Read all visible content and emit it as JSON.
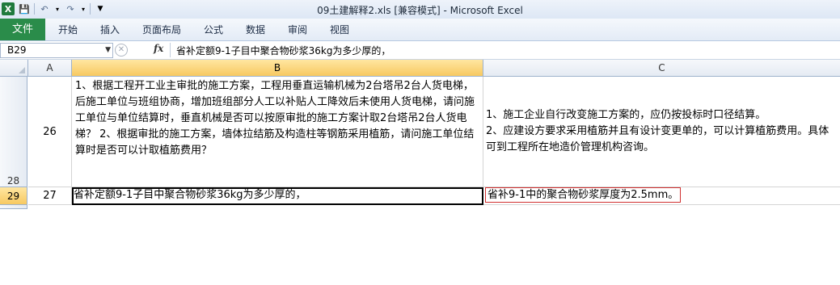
{
  "window": {
    "title": "09土建解释2.xls  [兼容模式]  -  Microsoft Excel"
  },
  "quick_access": {
    "app_icon": "excel-icon",
    "save_icon": "save-icon",
    "undo_icon": "undo-icon",
    "redo_icon": "redo-icon",
    "customize_icon": "chevron-down-icon"
  },
  "ribbon": {
    "file_tab": "文件",
    "tabs": [
      "开始",
      "插入",
      "页面布局",
      "公式",
      "数据",
      "审阅",
      "视图"
    ]
  },
  "formula_bar": {
    "name_box": "B29",
    "fx_label": "fx",
    "content": "省补定额9-1子目中聚合物砂浆36kg为多少厚的，"
  },
  "columns": [
    "A",
    "B",
    "C"
  ],
  "active_column": "B",
  "rows": [
    {
      "row_number": "28",
      "A": "26",
      "B": "1、根据工程开工业主审批的施工方案，工程用垂直运输机械为2台塔吊2台人货电梯，后施工单位与班组协商，增加班组部分人工以补贴人工降效后未使用人货电梯，请问施工单位与单位结算时，垂直机械是否可以按原审批的施工方案计取2台塔吊2台人货电梯？ 2、根据审批的施工方案，墙体拉结筋及构造柱等钢筋采用植筋，请问施工单位结算时是否可以计取植筋费用？",
      "C": "1、施工企业自行改变施工方案的，应仍按投标时口径结算。\n2、应建设方要求采用植筋并且有设计变更单的，可以计算植筋费用。具体可到工程所在地造价管理机构咨询。"
    },
    {
      "row_number": "29",
      "A": "27",
      "B": "省补定额9-1子目中聚合物砂浆36kg为多少厚的，",
      "C": "省补9-1中的聚合物砂浆厚度为2.5mm。"
    }
  ],
  "colors": {
    "file_tab": "#2a8c4a",
    "active_header": "#f7c961",
    "highlight_border": "#d03030"
  }
}
